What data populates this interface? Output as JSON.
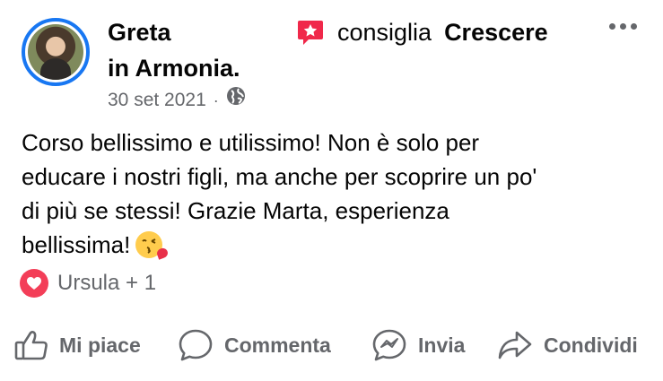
{
  "post": {
    "author": {
      "line1": "Greta",
      "line2": "in Armonia."
    },
    "recommends_verb": "consiglia",
    "recommended_page": "Crescere",
    "date": "30 set 2021",
    "separator": "·",
    "privacy_icon": "globe-icon",
    "text_lines": [
      "Corso bellissimo e utilissimo! Non è solo per",
      "educare i nostri figli, ma anche per scoprire un po'",
      "di più se stessi! Grazie Marta, esperienza",
      "bellissima!"
    ],
    "emoji": "face-blowing-kiss-emoji"
  },
  "reactions": {
    "type": "love",
    "summary": "Ursula + 1"
  },
  "actions": [
    {
      "label": "Mi piace",
      "icon": "thumbs-up-icon"
    },
    {
      "label": "Commenta",
      "icon": "comment-bubble-icon"
    },
    {
      "label": "Invia",
      "icon": "messenger-icon"
    },
    {
      "label": "Condividi",
      "icon": "share-arrow-icon"
    }
  ],
  "colors": {
    "avatar_ring": "#1877f2",
    "recommend_badge": "#f0284a",
    "love_badge": "#f33e58",
    "secondary_text": "#65676b"
  }
}
